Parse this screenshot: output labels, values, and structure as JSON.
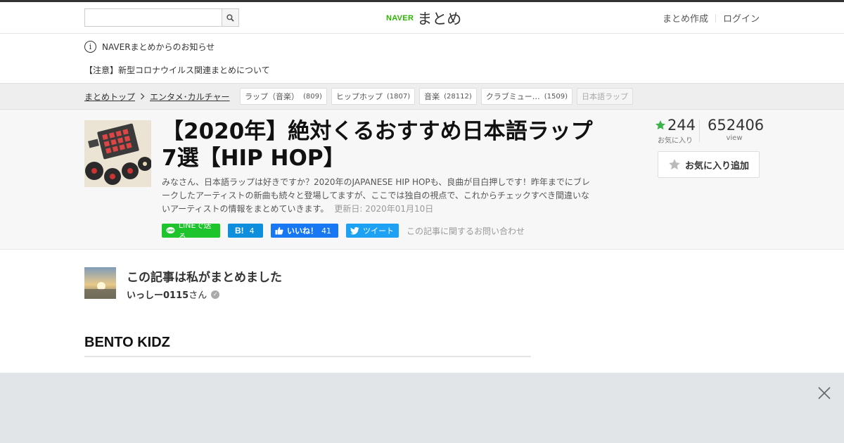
{
  "header": {
    "search_placeholder": "",
    "logo_brand": "NAVER",
    "logo_service": "まとめ",
    "links": [
      "まとめ作成",
      "ログイン"
    ]
  },
  "notice": {
    "heading": "NAVERまとめからのお知らせ",
    "link": "【注意】新型コロナウイルス関連まとめについて"
  },
  "breadcrumb": {
    "items": [
      "まとめトップ",
      "エンタメ･カルチャー"
    ]
  },
  "tags": [
    {
      "label": "ラップ（音楽）",
      "count": "(809)"
    },
    {
      "label": "ヒップホップ",
      "count": "(1807)"
    },
    {
      "label": "音楽",
      "count": "(28112)"
    },
    {
      "label": "クラブミュー…",
      "count": "(1509)"
    },
    {
      "label": "日本語ラップ",
      "count": ""
    }
  ],
  "article": {
    "title": "【2020年】絶対くるおすすめ日本語ラップ7選【HIP HOP】",
    "description": "みなさん、日本語ラップは好きですか？2020年のJAPANESE HIP HOPも、良曲が目白押しです！昨年までにブレークしたアーティストの新曲も続々と登場してますが、ここでは独自の視点で、これからチェックすべき間違いないアーティストの情報をまとめていきます。",
    "updated": "更新日: 2020年01月10日",
    "favorites": "244",
    "favorites_label": "お気に入り",
    "views": "652406",
    "views_label": "view",
    "fav_button": "お気に入り追加"
  },
  "social": {
    "line": "LINEで送る",
    "hatena_count": "4",
    "fb_label": "いいね！",
    "fb_count": "41",
    "tweet": "ツイート",
    "contact": "この記事に関するお問い合わせ"
  },
  "author": {
    "heading": "この記事は私がまとめました",
    "name": "いっしー0115",
    "suffix": "さん"
  },
  "section": {
    "heading": "BENTO KIDZ"
  },
  "colors": {
    "naver_green": "#2db400",
    "line_green": "#1dc42b",
    "hatena_blue": "#0d8fde",
    "facebook_blue": "#1877f2",
    "twitter_blue": "#1da1f2",
    "star_green": "#3cb44b"
  }
}
